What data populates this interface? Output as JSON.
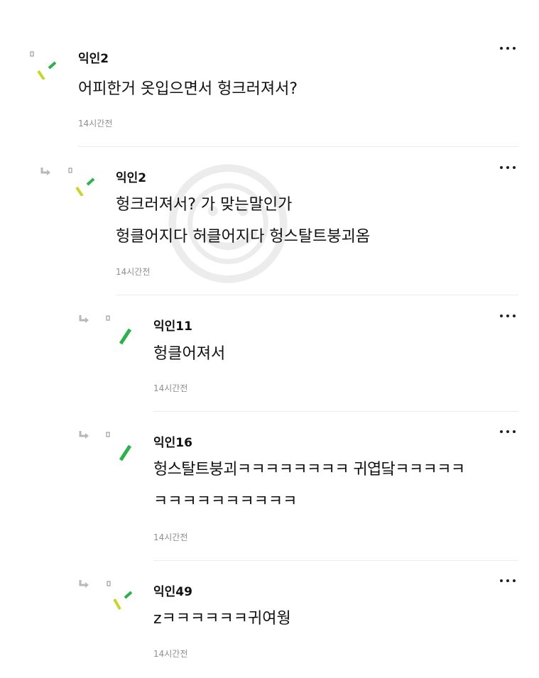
{
  "comments": [
    {
      "author": "익인2",
      "lines": [
        "어피한거 옷입으면서 헝크러져서?"
      ],
      "time": "14시간전",
      "avatar": "green-yellow-check"
    },
    {
      "author": "익인2",
      "lines": [
        "헝크러져서? 가 맞는말인가",
        "헝클어지다 허클어지다 헝스탈트붕괴옴"
      ],
      "time": "14시간전",
      "avatar": "green-yellow-check"
    },
    {
      "author": "익인11",
      "lines": [
        "헝클어져서"
      ],
      "time": "14시간전",
      "avatar": "green-slash"
    },
    {
      "author": "익인16",
      "lines": [
        "헝스탈트붕괴ㅋㅋㅋㅋㅋㅋㅋㅋ 귀엽닼ㅋㅋㅋㅋㅋ",
        "ㅋㅋㅋㅋㅋㅋㅋㅋㅋㅋ"
      ],
      "time": "14시간전",
      "avatar": "green-slash"
    },
    {
      "author": "익인49",
      "lines": [
        "zㅋㅋㅋㅋㅋㅋ귀여웡"
      ],
      "time": "14시간전",
      "avatar": "green-yellow-check"
    }
  ],
  "icons": {
    "reply": "reply-arrow-icon",
    "more": "more-options-icon",
    "watermark": "smiley-watermark"
  },
  "colors": {
    "avatar_green": "#2bb24c",
    "avatar_yellow": "#c9d52a",
    "time_gray": "#8e8e8e",
    "divider": "#ececec"
  }
}
